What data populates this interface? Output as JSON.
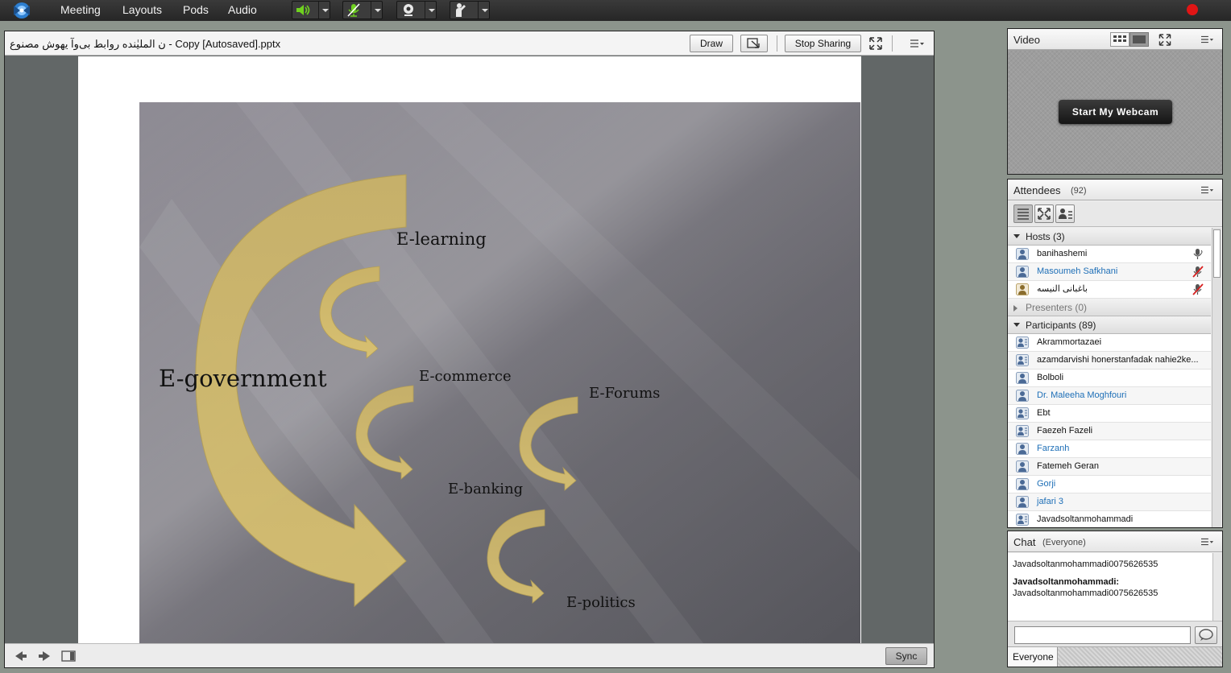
{
  "menu": {
    "items": [
      {
        "id": "meeting",
        "label": "Meeting"
      },
      {
        "id": "layouts",
        "label": "Layouts"
      },
      {
        "id": "pods",
        "label": "Pods"
      },
      {
        "id": "audio",
        "label": "Audio"
      }
    ]
  },
  "colors": {
    "accent_green": "#6fd21f",
    "record_red": "#e01515",
    "name_blue": "#1e6fb7",
    "arrow_gold": "#cdb567"
  },
  "share": {
    "title": "ن الملیٰنده روابط بی‌وآ یهوش مصنوع - Copy [Autosaved].pptx",
    "draw_label": "Draw",
    "stop_sharing_label": "Stop Sharing",
    "sync_label": "Sync"
  },
  "slide": {
    "labels": {
      "e_government": "E-government",
      "e_learning": "E-learning",
      "e_commerce": "E-commerce",
      "e_forums": "E-Forums",
      "e_banking": "E-banking",
      "e_politics": "E-politics"
    }
  },
  "video": {
    "title": "Video",
    "webcam_label": "Start My Webcam"
  },
  "attendees": {
    "title": "Attendees",
    "count": "(92)",
    "hosts_label": "Hosts (3)",
    "presenters_label": "Presenters (0)",
    "participants_label": "Participants (89)",
    "hosts": [
      {
        "name": "banihashemi",
        "blue": false,
        "mic": "on"
      },
      {
        "name": "Masoumeh Safkhani",
        "blue": true,
        "mic": "off"
      },
      {
        "name": "باغبانی النیسه",
        "blue": false,
        "mic": "off"
      }
    ],
    "participants": [
      {
        "name": "Akrammortazaei",
        "blue": false,
        "guest": true
      },
      {
        "name": "azamdarvishi honerstanfadak nahie2ke...",
        "blue": false,
        "guest": true
      },
      {
        "name": "Bolboli",
        "blue": false,
        "guest": false
      },
      {
        "name": "Dr. Maleeha Moghfouri",
        "blue": true,
        "guest": false
      },
      {
        "name": "Ebt",
        "blue": false,
        "guest": true
      },
      {
        "name": "Faezeh Fazeli",
        "blue": false,
        "guest": true
      },
      {
        "name": "Farzanh",
        "blue": true,
        "guest": false
      },
      {
        "name": "Fatemeh Geran",
        "blue": false,
        "guest": false
      },
      {
        "name": "Gorji",
        "blue": true,
        "guest": false
      },
      {
        "name": "jafari 3",
        "blue": true,
        "guest": false
      },
      {
        "name": "Javadsoltanmohammadi",
        "blue": false,
        "guest": true
      }
    ]
  },
  "chat": {
    "title": "Chat",
    "scope": "(Everyone)",
    "messages": {
      "line1": "Javadsoltanmohammadi0075626535",
      "sender": "Javadsoltanmohammadi:",
      "line2": "Javadsoltanmohammadi0075626535"
    },
    "input_placeholder": "",
    "recipient": "Everyone"
  }
}
